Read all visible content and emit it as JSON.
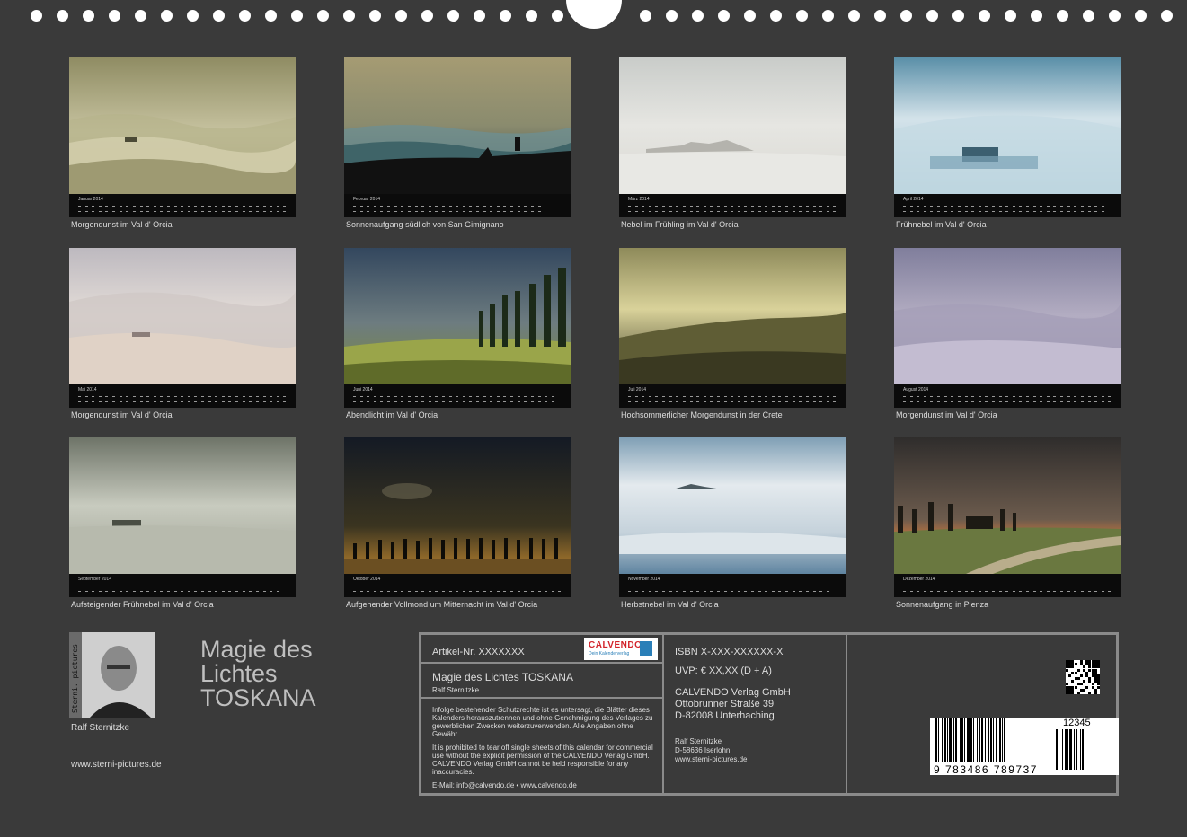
{
  "months": [
    {
      "name": "Januar 2014",
      "caption": "Morgendunst im Val d' Orcia",
      "days": 31
    },
    {
      "name": "Februar 2014",
      "caption": "Sonnenaufgang südlich von San Gimignano",
      "days": 28
    },
    {
      "name": "März 2014",
      "caption": "Nebel im Frühling im Val d' Orcia",
      "days": 31
    },
    {
      "name": "April 2014",
      "caption": "Frühnebel im Val d' Orcia",
      "days": 30
    },
    {
      "name": "Mai 2014",
      "caption": "Morgendunst im Val d' Orcia",
      "days": 31
    },
    {
      "name": "Juni 2014",
      "caption": "Abendlicht im Val d' Orcia",
      "days": 30
    },
    {
      "name": "Juli 2014",
      "caption": "Hochsommerlicher Morgendunst in der Crete",
      "days": 31
    },
    {
      "name": "August 2014",
      "caption": "Morgendunst im Val d' Orcia",
      "days": 31
    },
    {
      "name": "September 2014",
      "caption": "Aufsteigender Frühnebel im Val d' Orcia",
      "days": 30
    },
    {
      "name": "Oktober 2014",
      "caption": "Aufgehender Vollmond um Mitternacht im Val d' Orcia",
      "days": 31
    },
    {
      "name": "November 2014",
      "caption": "Herbstnebel im Val d' Orcia",
      "days": 30
    },
    {
      "name": "Dezember 2014",
      "caption": "Sonnenaufgang in Pienza",
      "days": 31
    }
  ],
  "author": {
    "name": "Ralf Sternitzke",
    "website": "www.sterni-pictures.de",
    "photo_band": "Sterni. pictures"
  },
  "title": {
    "line1": "Magie des",
    "line2": "Lichtes",
    "line3": "TOSKANA"
  },
  "info": {
    "article": "Artikel-Nr. XXXXXXX",
    "publisher_logo": "CALVENDO",
    "publisher_tagline": "Dein Kalenderverlag",
    "calendar_title": "Magie des Lichtes TOSKANA",
    "calendar_author": "Ralf Sternitzke",
    "legal_de": "Infolge bestehender Schutzrechte ist es untersagt, die Blätter dieses Kalenders herauszutrennen und ohne Genehmigung des Verlages zu gewerblichen Zwecken weiterzuverwenden. Alle Angaben ohne Gewähr.",
    "legal_en": "It is prohibited to tear off single sheets of this calendar for commercial use without the explicit permission of the CALVENDO Verlag GmbH. CALVENDO Verlag GmbH cannot be held responsible for any inaccuracies.",
    "contact": "E-Mail: info@calvendo.de • www.calvendo.de",
    "isbn": "ISBN X-XXX-XXXXXX-X",
    "price": "UVP: € XX,XX (D + A)",
    "publisher_name": "CALVENDO Verlag GmbH",
    "publisher_street": "Ottobrunner Straße 39",
    "publisher_city": "D-82008 Unterhaching",
    "author_name": "Ralf Sternitzke",
    "author_city": "D-58636 Iserlohn",
    "author_web": "www.sterni-pictures.de",
    "barcode_number": "9 783486 789737",
    "barcode_addon": "12345"
  },
  "colors": {
    "background": "#3a3a3a",
    "strip": "#0b0b0b",
    "border": "#8a8a8a",
    "calvendo_red": "#d2232a",
    "calvendo_blue": "#2a7fb8"
  }
}
